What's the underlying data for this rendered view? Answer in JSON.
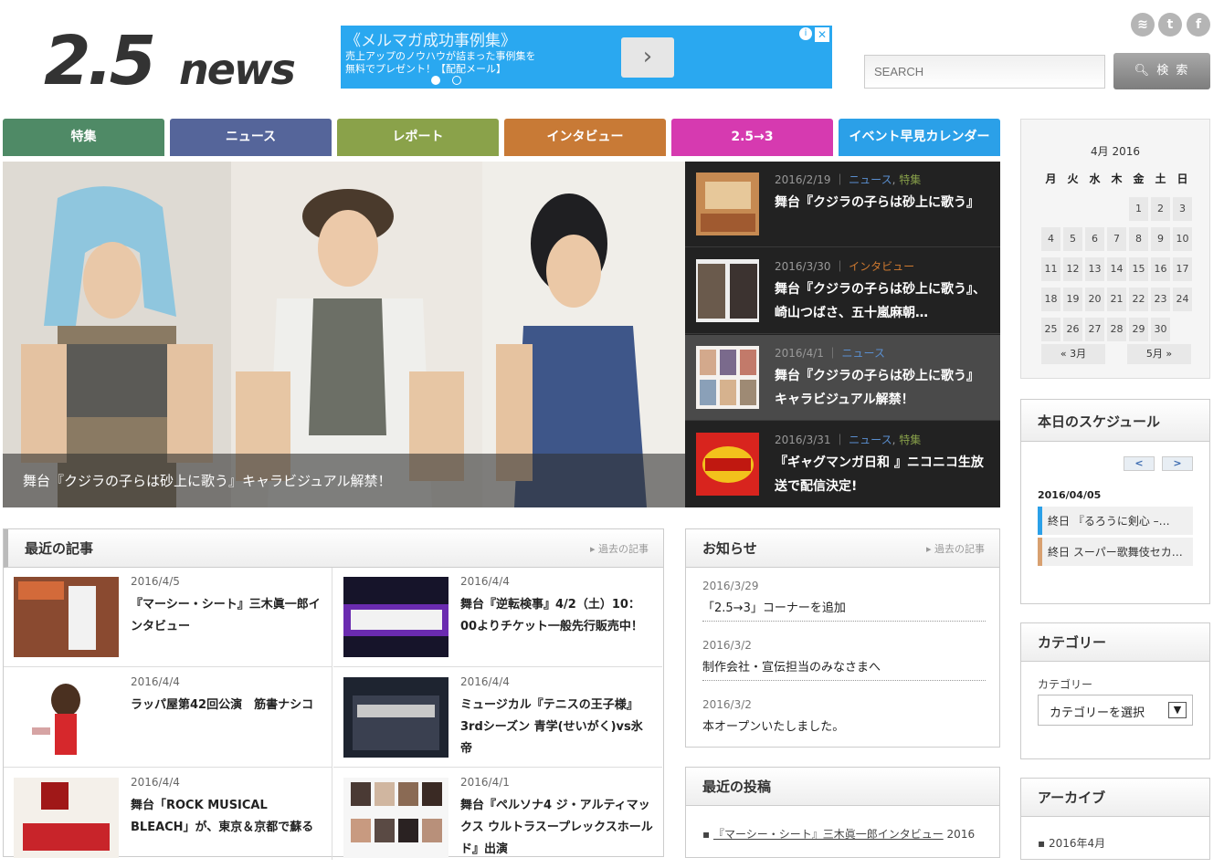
{
  "header": {
    "logo_text": "2.5news",
    "search_placeholder": "SEARCH",
    "search_button": "検 索",
    "social": [
      "rss-icon",
      "twitter-icon",
      "facebook-icon"
    ]
  },
  "ad": {
    "title": "《メルマガ成功事例集》",
    "line1": "売上アップのノウハウが詰まった事例集を",
    "line2": "無料でプレゼント！【配配メール】",
    "arrow": "›",
    "info": "i",
    "close": "✕"
  },
  "nav": [
    {
      "label": "特集",
      "color": "#4f8a66"
    },
    {
      "label": "ニュース",
      "color": "#55659a"
    },
    {
      "label": "レポート",
      "color": "#8aa24a"
    },
    {
      "label": "インタビュー",
      "color": "#c87a36"
    },
    {
      "label": "2.5→3",
      "color": "#d63ab0"
    },
    {
      "label": "イベント早見カレンダー",
      "color": "#2ba0e8"
    }
  ],
  "hero": {
    "caption": "舞台『クジラの子らは砂上に歌う』キャラビジュアル解禁！"
  },
  "features": [
    {
      "date": "2016/2/19",
      "cat": "ニュース",
      "cat2": "特集",
      "title": "舞台『クジラの子らは砂上に歌う』"
    },
    {
      "date": "2016/3/30",
      "cat": "インタビュー",
      "title": "舞台『クジラの子らは砂上に歌う』、崎山つばさ、五十嵐麻朝…"
    },
    {
      "date": "2016/4/1",
      "cat": "ニュース",
      "title": "舞台『クジラの子らは砂上に歌う』キャラビジュアル解禁！"
    },
    {
      "date": "2016/3/31",
      "cat": "ニュース",
      "cat2": "特集",
      "title": "『ギャグマンガ日和 』ニコニコ生放送で配信決定!"
    }
  ],
  "recent": {
    "heading": "最近の記事",
    "more": "過去の記事",
    "articles": [
      {
        "date": "2016/4/5",
        "title": "『マーシー・シート』三木眞一郎インタビュー"
      },
      {
        "date": "2016/4/4",
        "title": "舞台『逆転検事』4/2（土）10：00よりチケット一般先行販売中！"
      },
      {
        "date": "2016/4/4",
        "title": "ラッパ屋第42回公演　筋書ナシコ"
      },
      {
        "date": "2016/4/4",
        "title": "ミュージカル『テニスの王子様』3rdシーズン 青学(せいがく)vs氷帝"
      },
      {
        "date": "2016/4/4",
        "title": "舞台「ROCK MUSICAL BLEACH」が、東京＆京都で蘇る"
      },
      {
        "date": "2016/4/1",
        "title": "舞台『ペルソナ4 ジ・アルティマックス ウルトラスープレックスホールド』出演"
      }
    ]
  },
  "notice": {
    "heading": "お知らせ",
    "more": "過去の記事",
    "items": [
      {
        "date": "2016/3/29",
        "text": "「2.5→3」コーナーを追加"
      },
      {
        "date": "2016/3/2",
        "text": "制作会社・宣伝担当のみなさまへ"
      },
      {
        "date": "2016/3/2",
        "text": "本オープンいたしました。"
      }
    ]
  },
  "recent_posts": {
    "heading": "最近の投稿",
    "item": "『マーシー・シート』三木眞一郎インタビュー",
    "date": "2016"
  },
  "calendar": {
    "title": "4月 2016",
    "weekdays": [
      "月",
      "火",
      "水",
      "木",
      "金",
      "土",
      "日"
    ],
    "prev": "« 3月",
    "next": "5月 »"
  },
  "schedule": {
    "heading": "本日のスケジュール",
    "prev": "<",
    "next": ">",
    "date": "2016/04/05",
    "items": [
      {
        "text": "終日 『るろうに剣心 –…",
        "color": "#2ba0e8"
      },
      {
        "text": "終日 スーパー歌舞伎セカ…",
        "color": "#d8a070"
      }
    ]
  },
  "category": {
    "heading": "カテゴリー",
    "label": "カテゴリー",
    "select": "カテゴリーを選択"
  },
  "archive": {
    "heading": "アーカイブ",
    "item": "2016年4月"
  }
}
